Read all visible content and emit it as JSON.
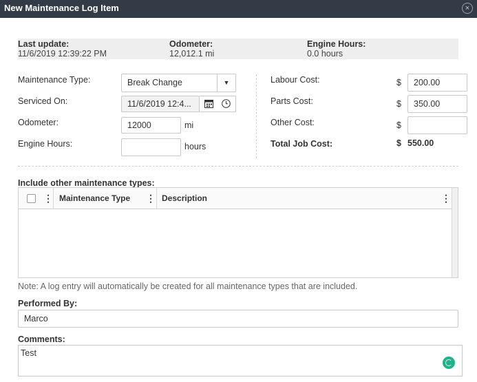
{
  "window": {
    "title": "New Maintenance Log Item",
    "close_glyph": "×"
  },
  "summary": {
    "last_update_label": "Last update:",
    "last_update_value": "11/6/2019 12:39:22 PM",
    "odometer_label": "Odometer:",
    "odometer_value": "12,012.1 mi",
    "engine_hours_label": "Engine Hours:",
    "engine_hours_value": "0.0 hours"
  },
  "form": {
    "maintenance_type_label": "Maintenance Type:",
    "maintenance_type_value": "Break Change",
    "serviced_on_label": "Serviced On:",
    "serviced_on_value": "11/6/2019 12:4...",
    "odometer_label": "Odometer:",
    "odometer_value": "12000",
    "odometer_unit": "mi",
    "engine_hours_label": "Engine Hours:",
    "engine_hours_value": "",
    "engine_hours_unit": "hours"
  },
  "costs": {
    "currency": "$",
    "labour_label": "Labour Cost:",
    "labour_value": "200.00",
    "parts_label": "Parts Cost:",
    "parts_value": "350.00",
    "other_label": "Other Cost:",
    "other_value": "",
    "total_label": "Total Job Cost:",
    "total_value": "550.00"
  },
  "other_types": {
    "label": "Include other maintenance types:",
    "columns": [
      "Maintenance Type",
      "Description"
    ]
  },
  "note": "Note: A log entry will automatically be created for all maintenance types that are included.",
  "performed_by": {
    "label": "Performed By:",
    "value": "Marco"
  },
  "comments": {
    "label": "Comments:",
    "value": "Test"
  },
  "colors": {
    "titlebar": "#333c46",
    "accent": "#1fb38a"
  },
  "icons": {
    "calendar": "calendar-icon",
    "clock": "clock-icon",
    "dropdown": "chevron-down-icon",
    "column_menu": "kebab-icon"
  }
}
